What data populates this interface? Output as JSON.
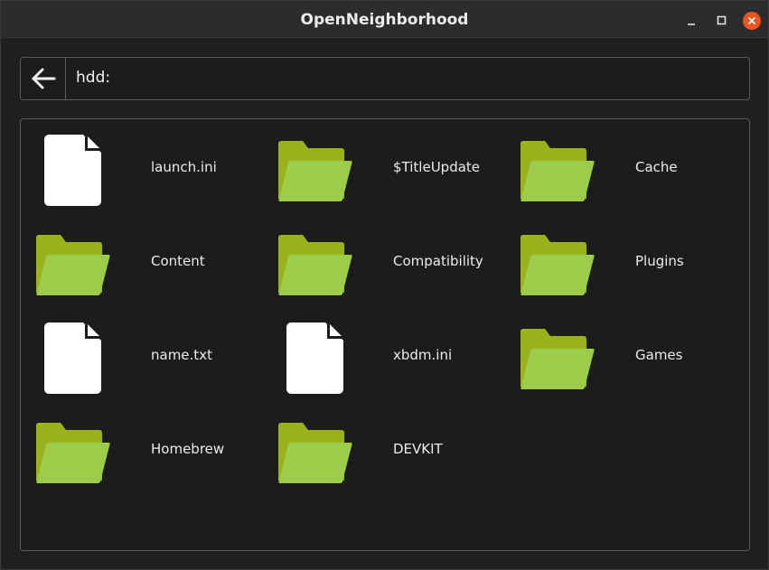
{
  "window": {
    "title": "OpenNeighborhood"
  },
  "address_bar": {
    "path": "hdd:"
  },
  "items": [
    {
      "name": "launch.ini",
      "type": "file",
      "icon": "file-icon"
    },
    {
      "name": "$TitleUpdate",
      "type": "folder",
      "icon": "folder-icon"
    },
    {
      "name": "Cache",
      "type": "folder",
      "icon": "folder-icon"
    },
    {
      "name": "Content",
      "type": "folder",
      "icon": "folder-icon"
    },
    {
      "name": "Compatibility",
      "type": "folder",
      "icon": "folder-icon"
    },
    {
      "name": "Plugins",
      "type": "folder",
      "icon": "folder-icon"
    },
    {
      "name": "name.txt",
      "type": "file",
      "icon": "file-icon"
    },
    {
      "name": "xbdm.ini",
      "type": "file",
      "icon": "file-icon"
    },
    {
      "name": "Games",
      "type": "folder",
      "icon": "folder-icon"
    },
    {
      "name": "Homebrew",
      "type": "folder",
      "icon": "folder-icon"
    },
    {
      "name": "DEVKIT",
      "type": "folder",
      "icon": "folder-icon"
    }
  ],
  "colors": {
    "folder_back": "#9bb21c",
    "folder_front": "#9ccc4a",
    "file": "#ffffff",
    "close_button": "#e95420"
  }
}
